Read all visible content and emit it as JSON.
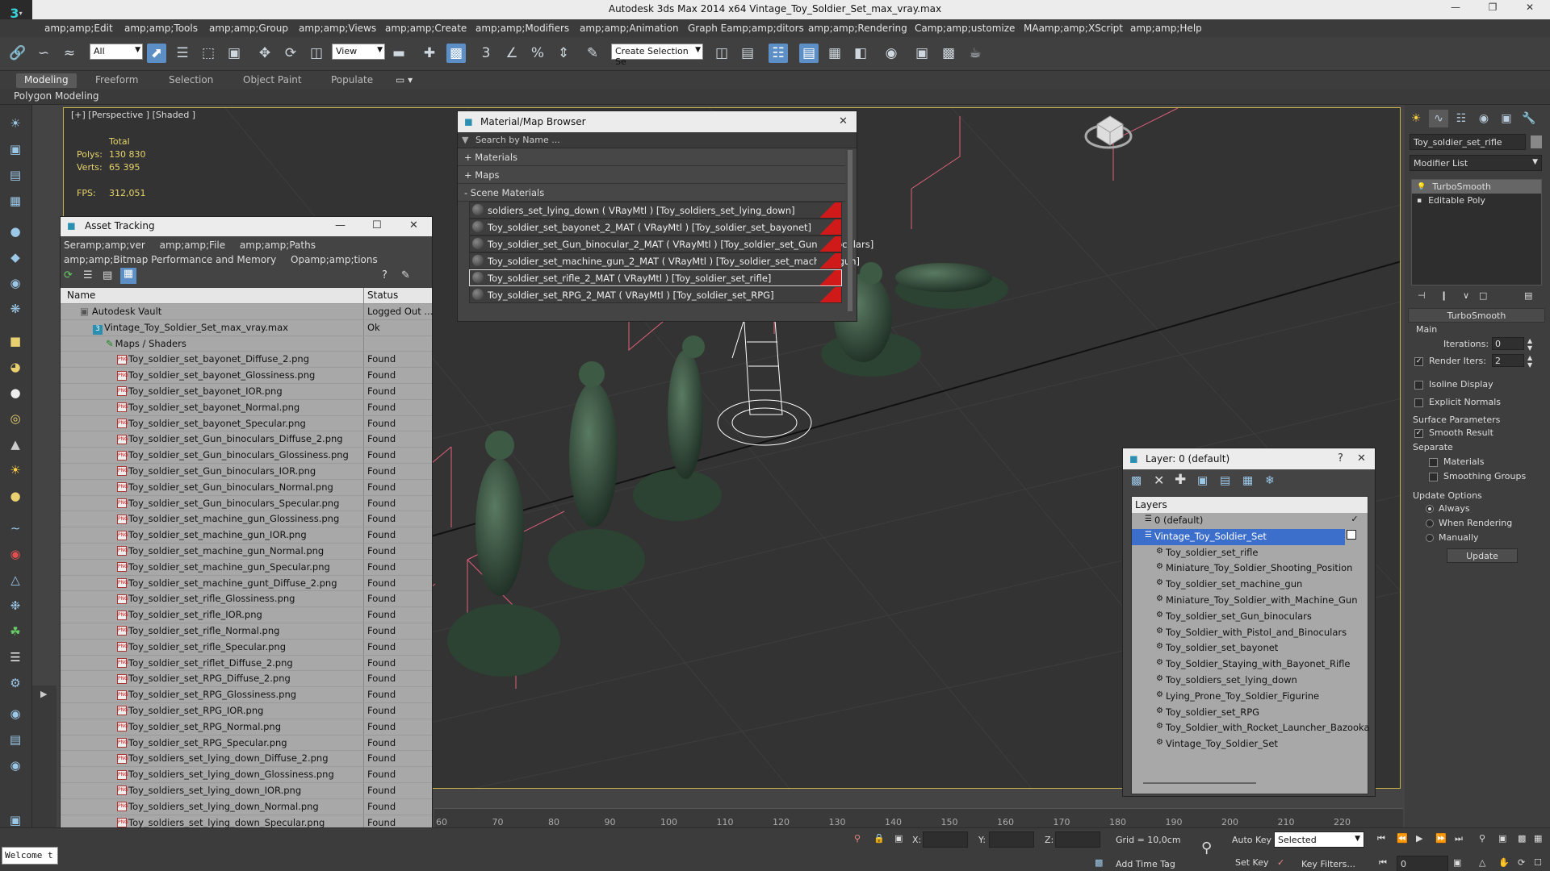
{
  "window": {
    "title": "Autodesk 3ds Max  2014 x64     Vintage_Toy_Soldier_Set_max_vray.max",
    "logo": "3"
  },
  "menu": [
    "amp;amp;Edit",
    "amp;amp;Tools",
    "amp;amp;Group",
    "amp;amp;Views",
    "amp;amp;Create",
    "amp;amp;Modifiers",
    "amp;amp;Animation",
    "Graph Eamp;amp;ditors",
    "amp;amp;Rendering",
    "Camp;amp;ustomize",
    "MAamp;amp;XScript",
    "amp;amp;Help"
  ],
  "toolbar": {
    "filter": "All",
    "view": "View",
    "selection_set": "Create Selection Se",
    "snap_num": "3",
    "percent": "%"
  },
  "ribbon": {
    "tabs": [
      "Modeling",
      "Freeform",
      "Selection",
      "Object Paint",
      "Populate"
    ],
    "panel": "Polygon Modeling"
  },
  "viewport": {
    "label": "[+] [Perspective ] [Shaded ]",
    "stats": {
      "total": "Total",
      "polys_label": "Polys:",
      "polys": "130 830",
      "verts_label": "Verts:",
      "verts": "65 395",
      "fps_label": "FPS:",
      "fps": "312,051"
    }
  },
  "asset_tracking": {
    "title": "Asset Tracking",
    "menu": [
      "Seramp;amp;ver",
      "amp;amp;File",
      "amp;amp;Paths",
      "amp;amp;Bitmap Performance and Memory",
      "Opamp;amp;tions"
    ],
    "columns": [
      "Name",
      "Status"
    ],
    "rows": [
      {
        "name": "Autodesk Vault",
        "status": "Logged Out ...",
        "level": 0,
        "icon": "vault"
      },
      {
        "name": "Vintage_Toy_Soldier_Set_max_vray.max",
        "status": "Ok",
        "level": 1,
        "icon": "max"
      },
      {
        "name": "Maps / Shaders",
        "status": "",
        "level": 2,
        "icon": "maps"
      },
      {
        "name": "Toy_soldier_set_bayonet_Diffuse_2.png",
        "status": "Found",
        "level": 3,
        "icon": "png"
      },
      {
        "name": "Toy_soldier_set_bayonet_Glossiness.png",
        "status": "Found",
        "level": 3,
        "icon": "png"
      },
      {
        "name": "Toy_soldier_set_bayonet_IOR.png",
        "status": "Found",
        "level": 3,
        "icon": "png"
      },
      {
        "name": "Toy_soldier_set_bayonet_Normal.png",
        "status": "Found",
        "level": 3,
        "icon": "png"
      },
      {
        "name": "Toy_soldier_set_bayonet_Specular.png",
        "status": "Found",
        "level": 3,
        "icon": "png"
      },
      {
        "name": "Toy_soldier_set_Gun_binoculars_Diffuse_2.png",
        "status": "Found",
        "level": 3,
        "icon": "png"
      },
      {
        "name": "Toy_soldier_set_Gun_binoculars_Glossiness.png",
        "status": "Found",
        "level": 3,
        "icon": "png"
      },
      {
        "name": "Toy_soldier_set_Gun_binoculars_IOR.png",
        "status": "Found",
        "level": 3,
        "icon": "png"
      },
      {
        "name": "Toy_soldier_set_Gun_binoculars_Normal.png",
        "status": "Found",
        "level": 3,
        "icon": "png"
      },
      {
        "name": "Toy_soldier_set_Gun_binoculars_Specular.png",
        "status": "Found",
        "level": 3,
        "icon": "png"
      },
      {
        "name": "Toy_soldier_set_machine_gun_Glossiness.png",
        "status": "Found",
        "level": 3,
        "icon": "png"
      },
      {
        "name": "Toy_soldier_set_machine_gun_IOR.png",
        "status": "Found",
        "level": 3,
        "icon": "png"
      },
      {
        "name": "Toy_soldier_set_machine_gun_Normal.png",
        "status": "Found",
        "level": 3,
        "icon": "png"
      },
      {
        "name": "Toy_soldier_set_machine_gun_Specular.png",
        "status": "Found",
        "level": 3,
        "icon": "png"
      },
      {
        "name": "Toy_soldier_set_machine_gunt_Diffuse_2.png",
        "status": "Found",
        "level": 3,
        "icon": "png"
      },
      {
        "name": "Toy_soldier_set_rifle_Glossiness.png",
        "status": "Found",
        "level": 3,
        "icon": "png"
      },
      {
        "name": "Toy_soldier_set_rifle_IOR.png",
        "status": "Found",
        "level": 3,
        "icon": "png"
      },
      {
        "name": "Toy_soldier_set_rifle_Normal.png",
        "status": "Found",
        "level": 3,
        "icon": "png"
      },
      {
        "name": "Toy_soldier_set_rifle_Specular.png",
        "status": "Found",
        "level": 3,
        "icon": "png"
      },
      {
        "name": "Toy_soldier_set_riflet_Diffuse_2.png",
        "status": "Found",
        "level": 3,
        "icon": "png"
      },
      {
        "name": "Toy_soldier_set_RPG_Diffuse_2.png",
        "status": "Found",
        "level": 3,
        "icon": "png"
      },
      {
        "name": "Toy_soldier_set_RPG_Glossiness.png",
        "status": "Found",
        "level": 3,
        "icon": "png"
      },
      {
        "name": "Toy_soldier_set_RPG_IOR.png",
        "status": "Found",
        "level": 3,
        "icon": "png"
      },
      {
        "name": "Toy_soldier_set_RPG_Normal.png",
        "status": "Found",
        "level": 3,
        "icon": "png"
      },
      {
        "name": "Toy_soldier_set_RPG_Specular.png",
        "status": "Found",
        "level": 3,
        "icon": "png"
      },
      {
        "name": "Toy_soldiers_set_lying_down_Diffuse_2.png",
        "status": "Found",
        "level": 3,
        "icon": "png"
      },
      {
        "name": "Toy_soldiers_set_lying_down_Glossiness.png",
        "status": "Found",
        "level": 3,
        "icon": "png"
      },
      {
        "name": "Toy_soldiers_set_lying_down_IOR.png",
        "status": "Found",
        "level": 3,
        "icon": "png"
      },
      {
        "name": "Toy_soldiers_set_lying_down_Normal.png",
        "status": "Found",
        "level": 3,
        "icon": "png"
      },
      {
        "name": "Toy_soldiers_set_lying_down_Specular.png",
        "status": "Found",
        "level": 3,
        "icon": "png"
      }
    ]
  },
  "material_browser": {
    "title": "Material/Map Browser",
    "search_placeholder": "Search by Name ...",
    "sections": [
      "+ Materials",
      "+ Maps",
      "- Scene Materials"
    ],
    "materials": [
      "soldiers_set_lying_down ( VRayMtl ) [Toy_soldiers_set_lying_down]",
      "Toy_soldier_set_bayonet_2_MAT ( VRayMtl ) [Toy_soldier_set_bayonet]",
      "Toy_soldier_set_Gun_binocular_2_MAT ( VRayMtl ) [Toy_soldier_set_Gun_binoculars]",
      "Toy_soldier_set_machine_gun_2_MAT ( VRayMtl ) [Toy_soldier_set_machine_gun]",
      "Toy_soldier_set_rifle_2_MAT ( VRayMtl ) [Toy_soldier_set_rifle]",
      "Toy_soldier_set_RPG_2_MAT ( VRayMtl ) [Toy_soldier_set_RPG]"
    ],
    "selected_index": 4
  },
  "layer_dialog": {
    "title": "Layer: 0 (default)",
    "help": "?",
    "header": "Layers",
    "items": [
      {
        "name": "0 (default)",
        "indent": 0,
        "check": "✓"
      },
      {
        "name": "Vintage_Toy_Soldier_Set",
        "indent": 0,
        "check": "",
        "selected": true
      },
      {
        "name": "Toy_soldier_set_rifle",
        "indent": 1
      },
      {
        "name": "Miniature_Toy_Soldier_Shooting_Position",
        "indent": 1
      },
      {
        "name": "Toy_soldier_set_machine_gun",
        "indent": 1
      },
      {
        "name": "Miniature_Toy_Soldier_with_Machine_Gun",
        "indent": 1
      },
      {
        "name": "Toy_soldier_set_Gun_binoculars",
        "indent": 1
      },
      {
        "name": "Toy_Soldier_with_Pistol_and_Binoculars",
        "indent": 1
      },
      {
        "name": "Toy_soldier_set_bayonet",
        "indent": 1
      },
      {
        "name": "Toy_Soldier_Staying_with_Bayonet_Rifle",
        "indent": 1
      },
      {
        "name": "Toy_soldiers_set_lying_down",
        "indent": 1
      },
      {
        "name": "Lying_Prone_Toy_Soldier_Figurine",
        "indent": 1
      },
      {
        "name": "Toy_soldier_set_RPG",
        "indent": 1
      },
      {
        "name": "Toy_Soldier_with_Rocket_Launcher_Bazooka",
        "indent": 1
      },
      {
        "name": "Vintage_Toy_Soldier_Set",
        "indent": 1
      }
    ]
  },
  "command_panel": {
    "object_name": "Toy_soldier_set_rifle",
    "modifier_list": "Modifier List",
    "stack": [
      "TurboSmooth",
      "Editable Poly"
    ],
    "rollout_title": "TurboSmooth",
    "main_label": "Main",
    "iterations_label": "Iterations:",
    "iterations": "0",
    "render_iters_label": "Render Iters:",
    "render_iters": "2",
    "isoline": "Isoline Display",
    "explicit": "Explicit Normals",
    "surface_label": "Surface Parameters",
    "smooth_result": "Smooth Result",
    "separate_label": "Separate",
    "materials": "Materials",
    "smoothing_groups": "Smoothing Groups",
    "update_label": "Update Options",
    "always": "Always",
    "when_rendering": "When Rendering",
    "manually": "Manually",
    "update_btn": "Update"
  },
  "timeline": {
    "ticks": [
      "60",
      "70",
      "80",
      "90",
      "100",
      "110",
      "120",
      "130",
      "140",
      "150",
      "160",
      "170",
      "180",
      "190",
      "200",
      "210",
      "220"
    ]
  },
  "statusbar": {
    "welcome": "Welcome t",
    "x_label": "X:",
    "y_label": "Y:",
    "z_label": "Z:",
    "grid": "Grid = 10,0cm",
    "add_time_tag": "Add Time Tag",
    "auto_key": "Auto Key",
    "set_key": "Set Key",
    "selected": "Selected",
    "key_filters": "Key Filters...",
    "frame": "0"
  },
  "colors": {
    "selection_blue": "#3c6ecc",
    "viewport_border": "#c9b24b",
    "stats_yellow": "#e6d36a",
    "bbox_pink": "#e0607a",
    "soldier_green": "#34503c"
  }
}
